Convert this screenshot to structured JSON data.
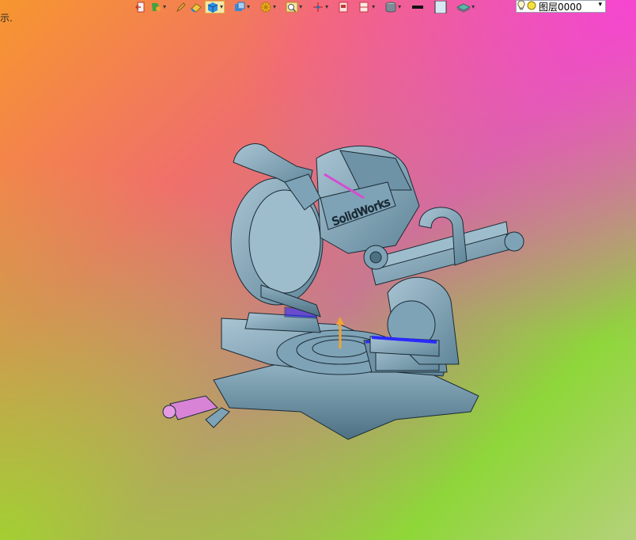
{
  "status": {
    "text": "示."
  },
  "toolbar": {
    "buttons": [
      {
        "icon": "exit-icon",
        "caret": false
      },
      {
        "icon": "paint-icon",
        "caret": true
      },
      {
        "icon": "pencil-icon",
        "caret": false
      },
      {
        "icon": "eraser-icon",
        "caret": false
      },
      {
        "icon": "cube-shaded-icon",
        "caret": true,
        "active": true
      },
      {
        "icon": "cube-view-icon",
        "caret": true
      },
      {
        "icon": "sun-icon",
        "caret": true
      },
      {
        "icon": "zoom-frame-icon",
        "caret": true
      },
      {
        "icon": "axis-icon",
        "caret": true
      },
      {
        "icon": "clip-icon",
        "caret": false
      },
      {
        "icon": "section-icon",
        "caret": true
      },
      {
        "icon": "cylinder-icon",
        "caret": true
      },
      {
        "icon": "line-weight-icon",
        "caret": false
      },
      {
        "icon": "color-swatch-icon",
        "caret": false
      },
      {
        "icon": "layers-icon",
        "caret": true
      }
    ]
  },
  "layer": {
    "value": "图层0000",
    "dropdown": "▾"
  }
}
